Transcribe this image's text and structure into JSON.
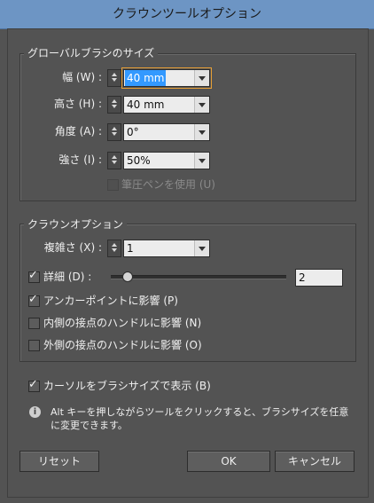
{
  "window": {
    "title": "クラウンツールオプション"
  },
  "brush_size": {
    "legend": "グローバルブラシのサイズ",
    "width": {
      "label": "幅 (W) :",
      "value": "40 mm"
    },
    "height": {
      "label": "高さ (H) :",
      "value": "40 mm"
    },
    "angle": {
      "label": "角度 (A) :",
      "value": "0°"
    },
    "intensity": {
      "label": "強さ (I) :",
      "value": "50%"
    },
    "use_pen_pressure": {
      "label": "筆圧ペンを使用 (U)",
      "checked": false,
      "enabled": false
    }
  },
  "crown_options": {
    "legend": "クラウンオプション",
    "complexity": {
      "label": "複雑さ (X) :",
      "value": "1"
    },
    "detail": {
      "label": "詳細 (D) :",
      "checked": true,
      "value": "2",
      "slider_fraction": 0.07
    },
    "affects_anchor": {
      "label": "アンカーポイントに影響 (P)",
      "checked": true
    },
    "affects_in_handles": {
      "label": "内側の接点のハンドルに影響 (N)",
      "checked": false
    },
    "affects_out_handles": {
      "label": "外側の接点のハンドルに影響 (O)",
      "checked": false
    }
  },
  "show_brush_size": {
    "label": "カーソルをブラシサイズで表示 (B)",
    "checked": true
  },
  "info": {
    "icon": "info-icon",
    "line1": "Alt キーを押しながらツールをクリックすると、ブラシサイズを任意",
    "line2": "に変更できます。"
  },
  "buttons": {
    "reset": "リセット",
    "ok": "OK",
    "cancel": "キャンセル"
  }
}
